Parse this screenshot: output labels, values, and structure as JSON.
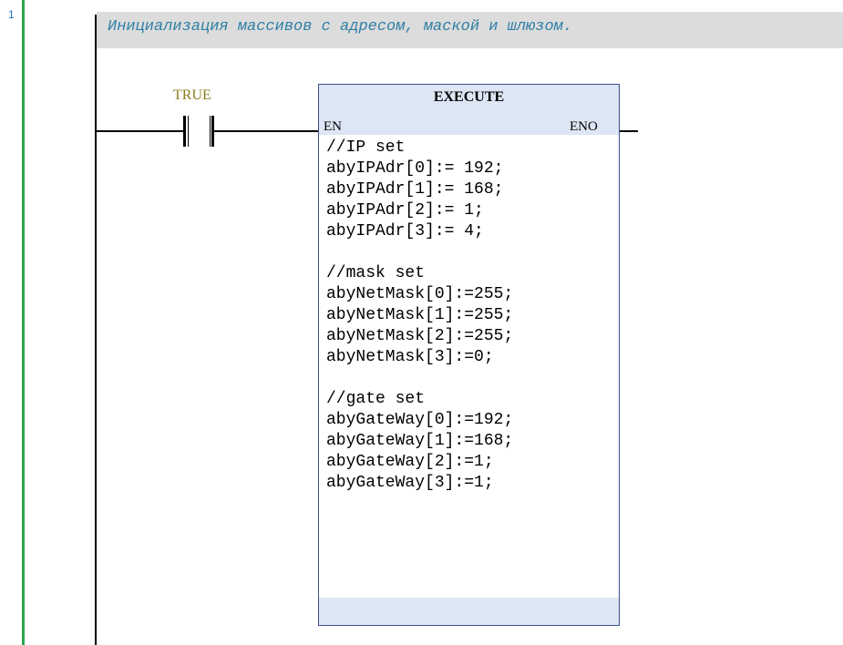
{
  "rung": {
    "number": "1",
    "comment": "Инициализация массивов с адресом, маской и шлюзом."
  },
  "contact": {
    "label": "TRUE",
    "icon": "normally-open-contact-icon"
  },
  "function_block": {
    "title": "EXECUTE",
    "input_pin": "EN",
    "output_pin": "ENO",
    "code_lines": [
      "//IP set",
      "abyIPAdr[0]:= 192;",
      "abyIPAdr[1]:= 168;",
      "abyIPAdr[2]:= 1;",
      "abyIPAdr[3]:= 4;",
      "",
      "//mask set",
      "abyNetMask[0]:=255;",
      "abyNetMask[1]:=255;",
      "abyNetMask[2]:=255;",
      "abyNetMask[3]:=0;",
      "",
      "//gate set",
      "abyGateWay[0]:=192;",
      "abyGateWay[1]:=168;",
      "abyGateWay[2]:=1;",
      "abyGateWay[3]:=1;"
    ]
  },
  "colors": {
    "rung_bar": "#2aa84a",
    "comment_text": "#2f7fa6",
    "comment_background": "#dcdcdc",
    "contact_label": "#8b7d1e",
    "block_header": "#dde6f5",
    "block_border": "#3b4e8c"
  }
}
